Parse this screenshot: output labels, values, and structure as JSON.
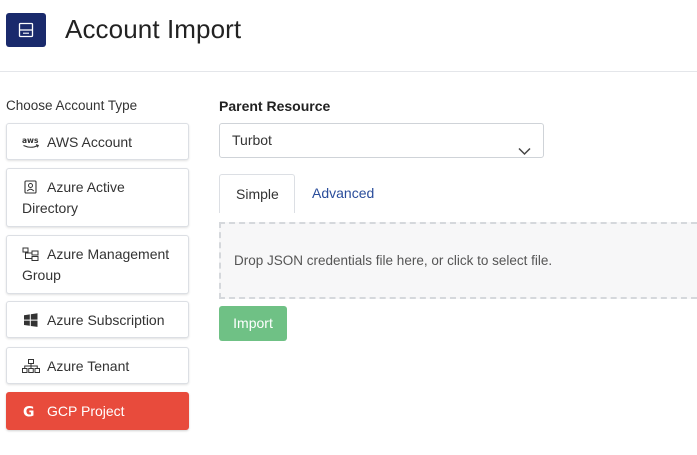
{
  "header": {
    "title": "Account Import",
    "logo_icon": "server-icon",
    "logo_color": "#1a2a6c"
  },
  "account_types": {
    "label": "Choose Account Type",
    "items": [
      {
        "label": "AWS Account",
        "icon": "aws-icon",
        "active": false
      },
      {
        "label": "Azure Active Directory",
        "icon": "user-badge-icon",
        "active": false
      },
      {
        "label": "Azure Management Group",
        "icon": "hierarchy-icon",
        "active": false
      },
      {
        "label": "Azure Subscription",
        "icon": "windows-icon",
        "active": false
      },
      {
        "label": "Azure Tenant",
        "icon": "org-chart-icon",
        "active": false
      },
      {
        "label": "GCP Project",
        "icon": "google-icon",
        "active": true
      }
    ],
    "active_color": "#e84b3c"
  },
  "parent_resource": {
    "label": "Parent Resource",
    "value": "Turbot"
  },
  "tabs": [
    {
      "label": "Simple",
      "active": true
    },
    {
      "label": "Advanced",
      "active": false
    }
  ],
  "dropzone": {
    "text": "Drop JSON credentials file here, or click to select file."
  },
  "import_button": {
    "label": "Import",
    "color": "#6fc185"
  }
}
